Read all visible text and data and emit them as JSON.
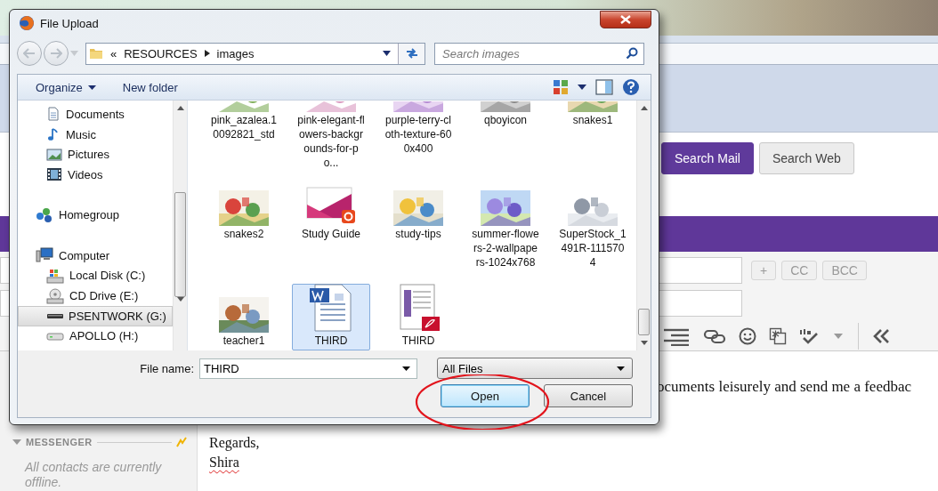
{
  "dialog": {
    "title": "File Upload",
    "address": {
      "overflow": "«",
      "path": [
        "RESOURCES",
        "images"
      ]
    },
    "search": {
      "placeholder": "Search images"
    },
    "toolbar": [
      {
        "label": "Organize",
        "kind": "menu"
      },
      {
        "label": "New folder",
        "kind": "button"
      }
    ],
    "nav": [
      {
        "children": [
          {
            "label": "Documents",
            "kind": "documents",
            "selected": false
          },
          {
            "label": "Music",
            "kind": "music",
            "selected": false
          },
          {
            "label": "Pictures",
            "kind": "pictures",
            "selected": false
          },
          {
            "label": "Videos",
            "kind": "videos",
            "selected": false
          }
        ]
      },
      {
        "label": "Homegroup",
        "kind": "homegroup",
        "selected": false
      },
      {
        "label": "Computer",
        "kind": "computer",
        "selected": false,
        "children": [
          {
            "label": "Local Disk (C:)",
            "kind": "disk",
            "selected": false
          },
          {
            "label": "CD Drive (E:)",
            "kind": "cd",
            "selected": false
          },
          {
            "label": "PSENTWORK (G:)",
            "kind": "netdrive",
            "selected": true
          },
          {
            "label": "APOLLO (H:)",
            "kind": "drive",
            "selected": false
          }
        ]
      }
    ],
    "files": [
      {
        "name": "pink_azalea.10092821_std",
        "kind": "picture",
        "selected": false
      },
      {
        "name": "pink-elegant-flowers-backgrounds-for-po...",
        "kind": "picture",
        "selected": false
      },
      {
        "name": "purple-terry-cloth-texture-600x400",
        "kind": "picture",
        "selected": false
      },
      {
        "name": "qboyicon",
        "kind": "picture",
        "selected": false
      },
      {
        "name": "snakes1",
        "kind": "picture",
        "selected": false
      },
      {
        "name": "snakes2",
        "kind": "picture",
        "selected": false
      },
      {
        "name": "Study Guide",
        "kind": "slides",
        "selected": false
      },
      {
        "name": "study-tips",
        "kind": "picture",
        "selected": false
      },
      {
        "name": "summer-flowers-2-wallpapers-1024x768",
        "kind": "picture",
        "selected": false
      },
      {
        "name": "SuperStock_1491R-1115704",
        "kind": "picture",
        "selected": false
      },
      {
        "name": "teacher1",
        "kind": "picture",
        "selected": false
      },
      {
        "name": "THIRD",
        "kind": "word",
        "selected": true
      },
      {
        "name": "THIRD",
        "kind": "pdf",
        "selected": false
      }
    ],
    "file_name": {
      "label": "File name:",
      "value": "THIRD"
    },
    "file_type": {
      "value": "All Files"
    },
    "buttons": [
      {
        "label": "Open",
        "default": true
      },
      {
        "label": "Cancel",
        "default": false
      }
    ]
  },
  "mail": {
    "search_buttons": [
      {
        "label": "Search Mail",
        "primary": true
      },
      {
        "label": "Search Web",
        "primary": false
      }
    ],
    "recipient_buttons": [
      "+",
      "CC",
      "BCC"
    ],
    "body_line": "ocuments leisurely and send me a feedbac",
    "signoff": [
      {
        "text": "Regards,",
        "misspelled": false
      },
      {
        "text": "Shira",
        "misspelled": true
      }
    ],
    "messenger": {
      "title": "MESSENGER",
      "status": "All contacts are currently offline."
    }
  }
}
